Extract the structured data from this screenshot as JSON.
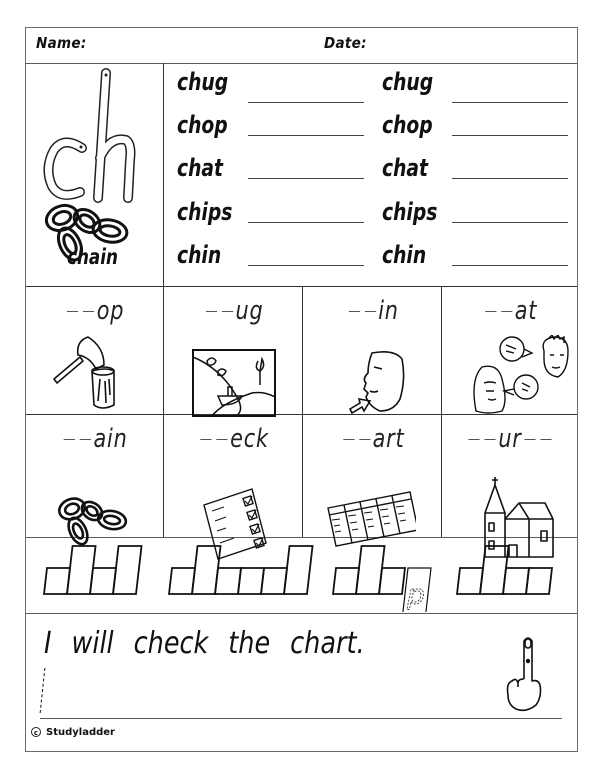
{
  "header": {
    "name_label": "Name:",
    "date_label": "Date:"
  },
  "digraph": {
    "letters": "ch",
    "picture_label": "chain",
    "picture_icon": "chain-icon"
  },
  "word_list": {
    "left": [
      "chug",
      "chop",
      "chat",
      "chips",
      "chin"
    ],
    "right": [
      "chug",
      "chop",
      "chat",
      "chips",
      "chin"
    ]
  },
  "fill_in": {
    "blank": "_ _",
    "cells": [
      {
        "ending": "op",
        "icon": "axe-chopping-stump-icon"
      },
      {
        "ending": "ug",
        "icon": "boat-river-scene-icon"
      },
      {
        "ending": "in",
        "icon": "face-pointing-chin-icon"
      },
      {
        "ending": "at",
        "icon": "people-chatting-icon"
      },
      {
        "ending": "ain",
        "icon": "chain-icon"
      },
      {
        "ending": "eck",
        "icon": "checklist-icon"
      },
      {
        "ending": "art",
        "icon": "timetable-chart-icon"
      },
      {
        "ending": "ur",
        "suffix_blank": true,
        "icon": "church-icon"
      }
    ]
  },
  "shape_boxes": [
    {
      "pattern": [
        "short",
        "tall",
        "short",
        "tall"
      ]
    },
    {
      "pattern": [
        "short",
        "tall",
        "short",
        "short",
        "short",
        "tall"
      ]
    },
    {
      "pattern": [
        "short",
        "tall",
        "short",
        "descender"
      ],
      "hint_letter": "p"
    },
    {
      "pattern": [
        "short",
        "tall",
        "short",
        "short"
      ]
    }
  ],
  "sentence": {
    "text": "I will check the chart.",
    "icon": "pointing-finger-icon"
  },
  "footer": {
    "copyright_symbol": "c",
    "brand": "Studyladder"
  }
}
